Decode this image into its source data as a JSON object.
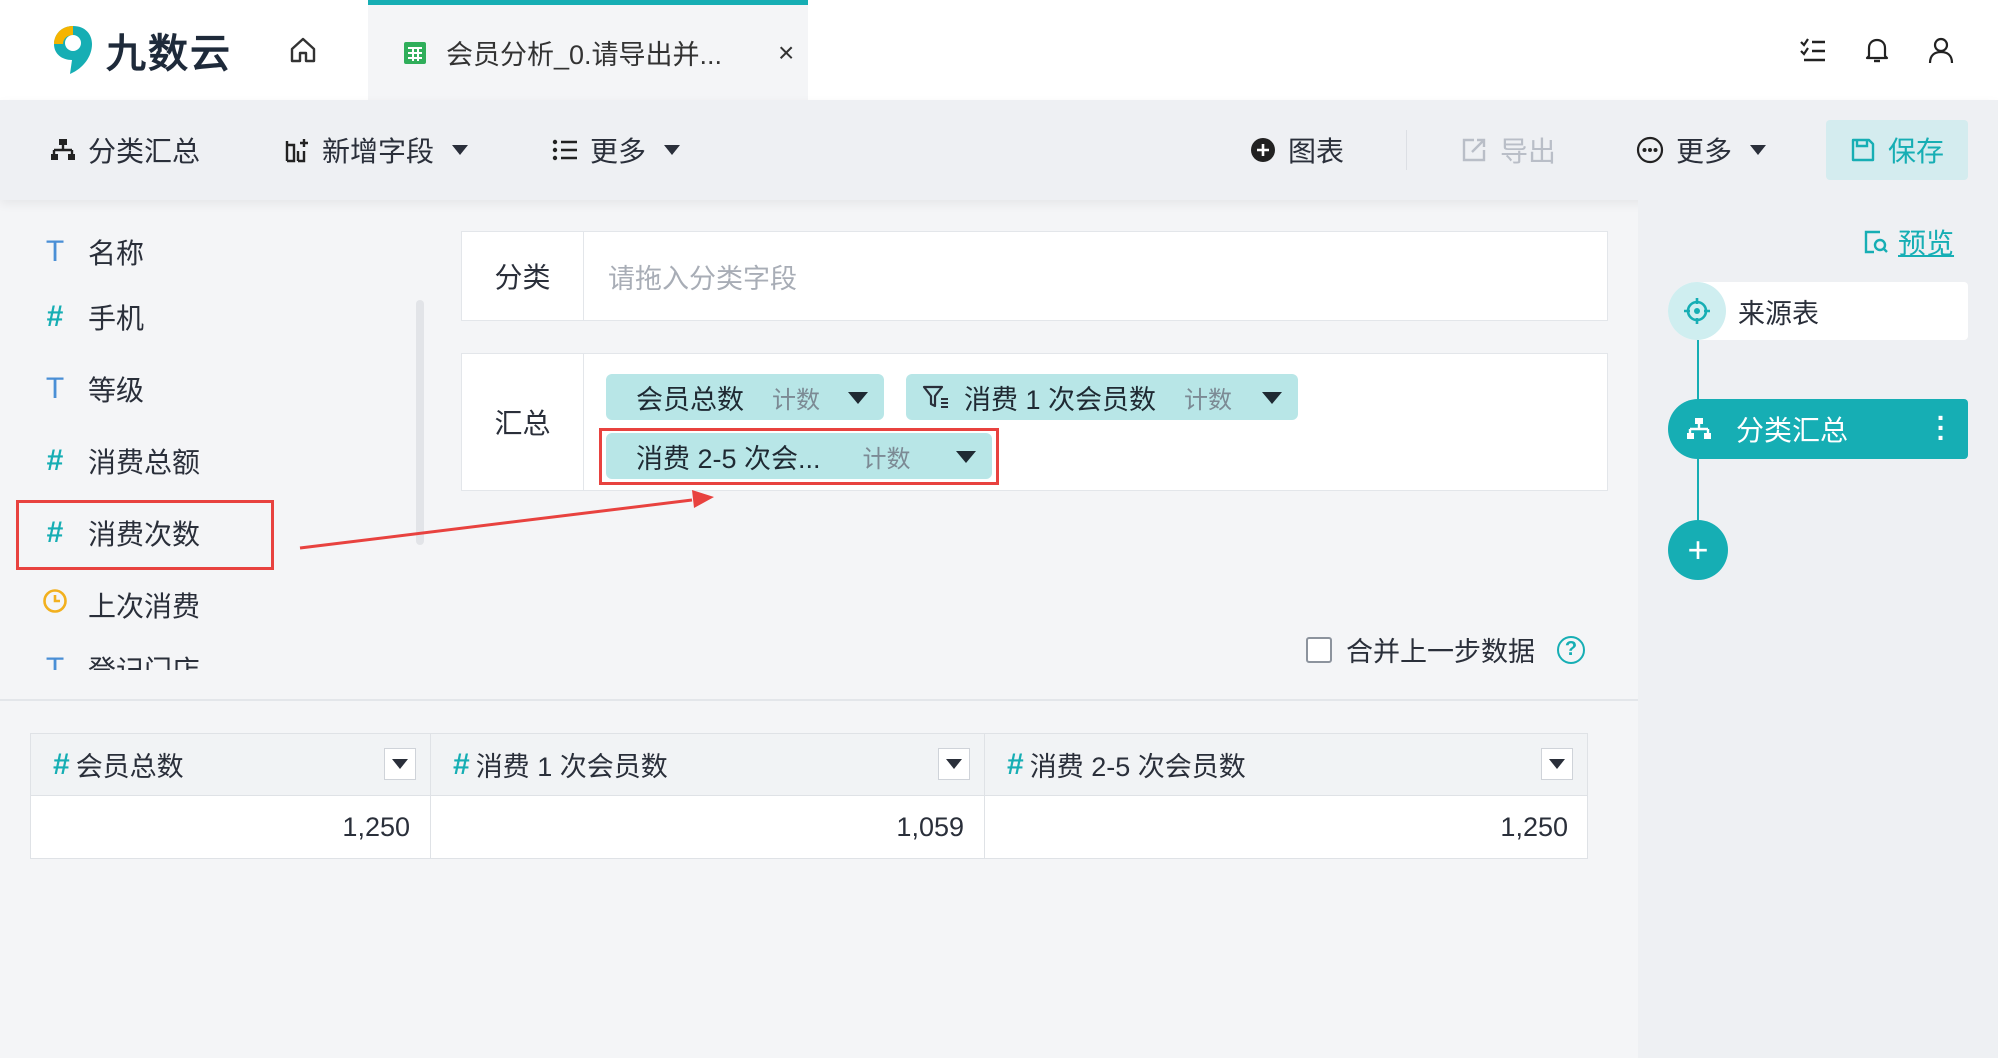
{
  "app": {
    "logo_text": "九数云"
  },
  "tab": {
    "title": "会员分析_0.请导出并...",
    "close": "×"
  },
  "toolbar": {
    "group_summary": "分类汇总",
    "add_field": "新增字段",
    "more_left": "更多",
    "chart": "图表",
    "export": "导出",
    "more_right": "更多",
    "save": "保存"
  },
  "fields": [
    {
      "type": "T",
      "label": "名称"
    },
    {
      "type": "#",
      "label": "手机"
    },
    {
      "type": "T",
      "label": "等级"
    },
    {
      "type": "#",
      "label": "消费总额"
    },
    {
      "type": "#",
      "label": "消费次数"
    },
    {
      "type": "clock",
      "label": "上次消费"
    },
    {
      "type": "T",
      "label": "登记门店"
    }
  ],
  "config": {
    "category_label": "分类",
    "category_placeholder": "请拖入分类字段",
    "summary_label": "汇总",
    "chips": [
      {
        "label": "会员总数",
        "agg": "计数"
      },
      {
        "label": "消费 1 次会员数",
        "agg": "计数"
      },
      {
        "label": "消费 2-5 次会...",
        "agg": "计数"
      }
    ],
    "merge_label": "合并上一步数据",
    "help": "?"
  },
  "result": {
    "columns": [
      "会员总数",
      "消费 1 次会员数",
      "消费 2-5 次会员数"
    ],
    "values": [
      "1,250",
      "1,059",
      "1,250"
    ]
  },
  "flow": {
    "preview": "预览",
    "source": "来源表",
    "current": "分类汇总",
    "add": "+"
  },
  "colors": {
    "accent": "#16aeb4",
    "highlight": "#e8423f",
    "chip": "#b8e6e7"
  }
}
